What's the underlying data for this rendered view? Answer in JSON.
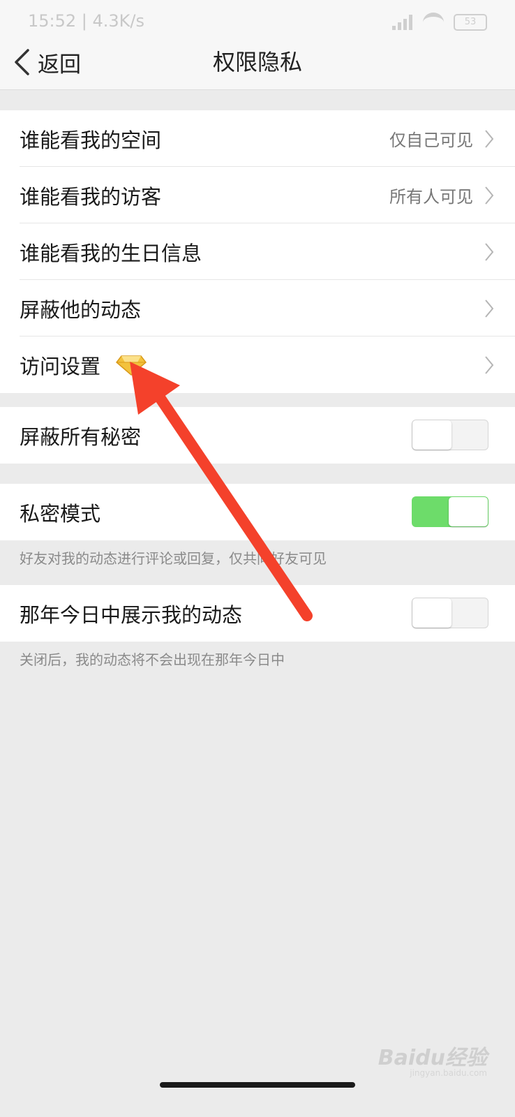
{
  "status_bar": {
    "time": "15:52 | 4.3K/s",
    "battery": "53"
  },
  "header": {
    "back_label": "返回",
    "title": "权限隐私"
  },
  "group1": [
    {
      "label": "谁能看我的空间",
      "value": "仅自己可见"
    },
    {
      "label": "谁能看我的访客",
      "value": "所有人可见"
    },
    {
      "label": "谁能看我的生日信息",
      "value": ""
    },
    {
      "label": "屏蔽他的动态",
      "value": ""
    },
    {
      "label": "访问设置",
      "value": ""
    }
  ],
  "toggles": {
    "block_secrets": {
      "label": "屏蔽所有秘密",
      "on": false
    },
    "private_mode": {
      "label": "私密模式",
      "on": true,
      "note": "好友对我的动态进行评论或回复，仅共同好友可见"
    },
    "memories": {
      "label": "那年今日中展示我的动态",
      "on": false,
      "note": "关闭后，我的动态将不会出现在那年今日中"
    }
  },
  "colors": {
    "toggle_on": "#6ddc6a",
    "annotation_arrow": "#f4412b",
    "vip_diamond": "#f3c23c"
  },
  "watermark": {
    "brand": "Baidu经验",
    "url": "jingyan.baidu.com"
  }
}
